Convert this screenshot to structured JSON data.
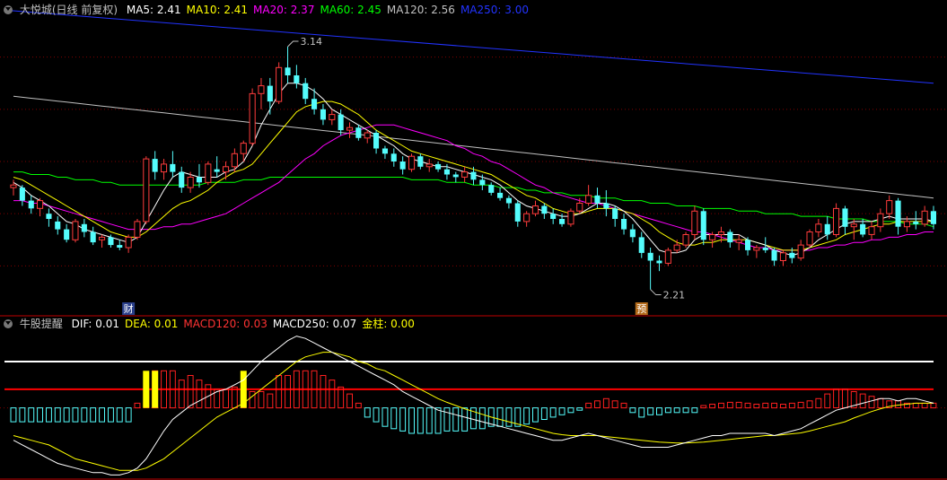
{
  "main_legend": {
    "title": "大悦城(日线 前复权)",
    "items": [
      {
        "label": "MA5: 2.41",
        "color": "#ffffff"
      },
      {
        "label": "MA10: 2.41",
        "color": "#ffff00"
      },
      {
        "label": "MA20: 2.37",
        "color": "#ff00ff"
      },
      {
        "label": "MA60: 2.45",
        "color": "#00ff00"
      },
      {
        "label": "MA120: 2.56",
        "color": "#c0c0c0"
      },
      {
        "label": "MA250: 3.00",
        "color": "#2233ff"
      }
    ]
  },
  "macd_legend": {
    "title": "牛股提醒",
    "items": [
      {
        "label": "DIF: 0.01",
        "color": "#ffffff"
      },
      {
        "label": "DEA: 0.01",
        "color": "#ffff00"
      },
      {
        "label": "MACD120: 0.03",
        "color": "#ff3333"
      },
      {
        "label": "MACD250: 0.07",
        "color": "#ffffff"
      },
      {
        "label": "金柱: 0.00",
        "color": "#ffff00"
      }
    ]
  },
  "annotations": {
    "high_label": "3.14",
    "low_label": "2.21",
    "marker_cai": "财",
    "marker_yu": "预"
  },
  "colors": {
    "up": "#ff3c3c",
    "down": "#54fcfc",
    "grid": "#800000",
    "ma5": "#ffffff",
    "ma10": "#ffff00",
    "ma20": "#ff00ff",
    "ma60": "#00ff00",
    "ma120": "#c0c0c0",
    "ma250": "#2233ff"
  },
  "chart_data": {
    "type": "candlestick",
    "price_range": [
      2.15,
      3.25
    ],
    "candles": [
      [
        2.6,
        2.63,
        2.57,
        2.61
      ],
      [
        2.6,
        2.61,
        2.53,
        2.55
      ],
      [
        2.55,
        2.57,
        2.5,
        2.52
      ],
      [
        2.52,
        2.56,
        2.49,
        2.55
      ],
      [
        2.5,
        2.52,
        2.45,
        2.48
      ],
      [
        2.47,
        2.49,
        2.42,
        2.44
      ],
      [
        2.44,
        2.46,
        2.39,
        2.4
      ],
      [
        2.4,
        2.48,
        2.39,
        2.47
      ],
      [
        2.46,
        2.48,
        2.41,
        2.43
      ],
      [
        2.43,
        2.45,
        2.38,
        2.39
      ],
      [
        2.4,
        2.42,
        2.37,
        2.41
      ],
      [
        2.41,
        2.42,
        2.37,
        2.38
      ],
      [
        2.38,
        2.4,
        2.36,
        2.37
      ],
      [
        2.37,
        2.42,
        2.35,
        2.41
      ],
      [
        2.41,
        2.48,
        2.4,
        2.47
      ],
      [
        2.47,
        2.72,
        2.46,
        2.71
      ],
      [
        2.71,
        2.74,
        2.63,
        2.66
      ],
      [
        2.66,
        2.71,
        2.63,
        2.69
      ],
      [
        2.69,
        2.74,
        2.64,
        2.66
      ],
      [
        2.66,
        2.68,
        2.58,
        2.6
      ],
      [
        2.6,
        2.66,
        2.58,
        2.64
      ],
      [
        2.64,
        2.69,
        2.6,
        2.62
      ],
      [
        2.62,
        2.7,
        2.61,
        2.69
      ],
      [
        2.67,
        2.72,
        2.64,
        2.66
      ],
      [
        2.66,
        2.7,
        2.63,
        2.68
      ],
      [
        2.68,
        2.75,
        2.66,
        2.73
      ],
      [
        2.73,
        2.78,
        2.7,
        2.77
      ],
      [
        2.77,
        2.98,
        2.76,
        2.96
      ],
      [
        2.96,
        3.02,
        2.9,
        2.99
      ],
      [
        2.99,
        3.02,
        2.88,
        2.93
      ],
      [
        2.93,
        3.08,
        2.92,
        3.06
      ],
      [
        3.06,
        3.14,
        3.0,
        3.03
      ],
      [
        3.03,
        3.07,
        2.98,
        3.0
      ],
      [
        3.0,
        3.02,
        2.92,
        2.94
      ],
      [
        2.94,
        2.98,
        2.88,
        2.9
      ],
      [
        2.9,
        2.92,
        2.84,
        2.86
      ],
      [
        2.86,
        2.9,
        2.84,
        2.88
      ],
      [
        2.88,
        2.9,
        2.8,
        2.82
      ],
      [
        2.82,
        2.85,
        2.79,
        2.83
      ],
      [
        2.83,
        2.84,
        2.78,
        2.79
      ],
      [
        2.79,
        2.82,
        2.77,
        2.81
      ],
      [
        2.81,
        2.82,
        2.73,
        2.75
      ],
      [
        2.75,
        2.76,
        2.71,
        2.73
      ],
      [
        2.73,
        2.75,
        2.68,
        2.7
      ],
      [
        2.7,
        2.72,
        2.65,
        2.67
      ],
      [
        2.67,
        2.73,
        2.66,
        2.72
      ],
      [
        2.72,
        2.73,
        2.67,
        2.68
      ],
      [
        2.68,
        2.71,
        2.66,
        2.69
      ],
      [
        2.69,
        2.7,
        2.66,
        2.67
      ],
      [
        2.67,
        2.69,
        2.63,
        2.65
      ],
      [
        2.65,
        2.66,
        2.62,
        2.64
      ],
      [
        2.64,
        2.68,
        2.62,
        2.66
      ],
      [
        2.66,
        2.68,
        2.61,
        2.63
      ],
      [
        2.63,
        2.65,
        2.59,
        2.61
      ],
      [
        2.61,
        2.62,
        2.57,
        2.58
      ],
      [
        2.58,
        2.6,
        2.55,
        2.56
      ],
      [
        2.56,
        2.57,
        2.52,
        2.54
      ],
      [
        2.54,
        2.55,
        2.45,
        2.47
      ],
      [
        2.47,
        2.51,
        2.45,
        2.5
      ],
      [
        2.5,
        2.55,
        2.49,
        2.53
      ],
      [
        2.53,
        2.54,
        2.48,
        2.5
      ],
      [
        2.5,
        2.52,
        2.46,
        2.48
      ],
      [
        2.48,
        2.5,
        2.45,
        2.46
      ],
      [
        2.46,
        2.52,
        2.45,
        2.51
      ],
      [
        2.51,
        2.56,
        2.5,
        2.54
      ],
      [
        2.54,
        2.61,
        2.53,
        2.57
      ],
      [
        2.57,
        2.6,
        2.52,
        2.54
      ],
      [
        2.54,
        2.59,
        2.49,
        2.52
      ],
      [
        2.52,
        2.53,
        2.45,
        2.48
      ],
      [
        2.48,
        2.5,
        2.42,
        2.44
      ],
      [
        2.44,
        2.46,
        2.39,
        2.41
      ],
      [
        2.41,
        2.43,
        2.33,
        2.35
      ],
      [
        2.35,
        2.37,
        2.21,
        2.32
      ],
      [
        2.32,
        2.34,
        2.28,
        2.31
      ],
      [
        2.31,
        2.37,
        2.3,
        2.36
      ],
      [
        2.36,
        2.4,
        2.35,
        2.38
      ],
      [
        2.38,
        2.43,
        2.37,
        2.42
      ],
      [
        2.42,
        2.53,
        2.4,
        2.51
      ],
      [
        2.51,
        2.52,
        2.38,
        2.4
      ],
      [
        2.4,
        2.43,
        2.37,
        2.42
      ],
      [
        2.42,
        2.45,
        2.39,
        2.43
      ],
      [
        2.43,
        2.44,
        2.37,
        2.39
      ],
      [
        2.39,
        2.42,
        2.36,
        2.4
      ],
      [
        2.4,
        2.41,
        2.34,
        2.36
      ],
      [
        2.36,
        2.38,
        2.33,
        2.37
      ],
      [
        2.37,
        2.41,
        2.35,
        2.36
      ],
      [
        2.36,
        2.37,
        2.3,
        2.32
      ],
      [
        2.32,
        2.36,
        2.3,
        2.35
      ],
      [
        2.35,
        2.37,
        2.31,
        2.33
      ],
      [
        2.33,
        2.4,
        2.32,
        2.38
      ],
      [
        2.38,
        2.44,
        2.37,
        2.43
      ],
      [
        2.43,
        2.48,
        2.41,
        2.46
      ],
      [
        2.46,
        2.49,
        2.4,
        2.42
      ],
      [
        2.42,
        2.54,
        2.41,
        2.52
      ],
      [
        2.52,
        2.53,
        2.42,
        2.45
      ],
      [
        2.45,
        2.48,
        2.4,
        2.46
      ],
      [
        2.46,
        2.48,
        2.41,
        2.42
      ],
      [
        2.42,
        2.47,
        2.4,
        2.45
      ],
      [
        2.45,
        2.52,
        2.43,
        2.5
      ],
      [
        2.5,
        2.57,
        2.48,
        2.55
      ],
      [
        2.55,
        2.56,
        2.42,
        2.45
      ],
      [
        2.45,
        2.49,
        2.43,
        2.47
      ],
      [
        2.47,
        2.51,
        2.44,
        2.46
      ],
      [
        2.46,
        2.53,
        2.45,
        2.51
      ],
      [
        2.51,
        2.53,
        2.44,
        2.46
      ]
    ],
    "ma5": [
      2.62,
      2.6,
      2.57,
      2.55,
      2.53,
      2.5,
      2.47,
      2.46,
      2.44,
      2.43,
      2.42,
      2.41,
      2.4,
      2.39,
      2.41,
      2.47,
      2.53,
      2.59,
      2.64,
      2.66,
      2.65,
      2.64,
      2.64,
      2.64,
      2.66,
      2.67,
      2.7,
      2.76,
      2.84,
      2.9,
      2.96,
      3.0,
      3.0,
      2.99,
      2.97,
      2.94,
      2.9,
      2.88,
      2.86,
      2.84,
      2.82,
      2.8,
      2.78,
      2.76,
      2.73,
      2.71,
      2.7,
      2.69,
      2.68,
      2.68,
      2.67,
      2.66,
      2.65,
      2.64,
      2.63,
      2.61,
      2.58,
      2.55,
      2.53,
      2.52,
      2.51,
      2.5,
      2.49,
      2.49,
      2.5,
      2.52,
      2.54,
      2.54,
      2.53,
      2.51,
      2.48,
      2.44,
      2.4,
      2.36,
      2.35,
      2.35,
      2.36,
      2.4,
      2.42,
      2.42,
      2.42,
      2.42,
      2.42,
      2.4,
      2.39,
      2.38,
      2.36,
      2.35,
      2.34,
      2.35,
      2.37,
      2.4,
      2.42,
      2.44,
      2.46,
      2.47,
      2.47,
      2.47,
      2.48,
      2.49,
      2.48,
      2.48,
      2.48,
      2.48,
      2.47
    ],
    "ma10": [
      2.64,
      2.63,
      2.61,
      2.59,
      2.57,
      2.55,
      2.53,
      2.51,
      2.49,
      2.47,
      2.45,
      2.43,
      2.42,
      2.41,
      2.41,
      2.43,
      2.46,
      2.49,
      2.52,
      2.54,
      2.55,
      2.57,
      2.59,
      2.62,
      2.64,
      2.66,
      2.67,
      2.69,
      2.73,
      2.77,
      2.81,
      2.85,
      2.89,
      2.91,
      2.92,
      2.93,
      2.93,
      2.92,
      2.9,
      2.88,
      2.85,
      2.82,
      2.8,
      2.78,
      2.76,
      2.74,
      2.73,
      2.72,
      2.71,
      2.7,
      2.69,
      2.68,
      2.67,
      2.66,
      2.65,
      2.63,
      2.61,
      2.59,
      2.57,
      2.56,
      2.54,
      2.52,
      2.51,
      2.5,
      2.5,
      2.51,
      2.52,
      2.52,
      2.52,
      2.51,
      2.5,
      2.48,
      2.46,
      2.43,
      2.41,
      2.39,
      2.38,
      2.38,
      2.39,
      2.39,
      2.4,
      2.4,
      2.4,
      2.4,
      2.39,
      2.38,
      2.37,
      2.36,
      2.36,
      2.36,
      2.37,
      2.38,
      2.39,
      2.4,
      2.42,
      2.43,
      2.44,
      2.45,
      2.46,
      2.46,
      2.47,
      2.47,
      2.47,
      2.47,
      2.47
    ],
    "ma20": [
      2.55,
      2.55,
      2.54,
      2.54,
      2.53,
      2.52,
      2.51,
      2.5,
      2.49,
      2.48,
      2.47,
      2.46,
      2.45,
      2.44,
      2.44,
      2.44,
      2.44,
      2.45,
      2.45,
      2.46,
      2.46,
      2.47,
      2.48,
      2.49,
      2.5,
      2.52,
      2.54,
      2.56,
      2.58,
      2.6,
      2.62,
      2.65,
      2.68,
      2.71,
      2.73,
      2.76,
      2.78,
      2.8,
      2.81,
      2.82,
      2.83,
      2.84,
      2.84,
      2.84,
      2.83,
      2.82,
      2.81,
      2.8,
      2.79,
      2.78,
      2.76,
      2.75,
      2.73,
      2.72,
      2.7,
      2.69,
      2.67,
      2.65,
      2.63,
      2.61,
      2.6,
      2.58,
      2.57,
      2.56,
      2.55,
      2.54,
      2.54,
      2.53,
      2.52,
      2.51,
      2.5,
      2.49,
      2.48,
      2.47,
      2.46,
      2.45,
      2.44,
      2.43,
      2.43,
      2.42,
      2.41,
      2.4,
      2.39,
      2.38,
      2.37,
      2.37,
      2.36,
      2.36,
      2.36,
      2.36,
      2.36,
      2.37,
      2.37,
      2.38,
      2.38,
      2.39,
      2.39,
      2.4,
      2.4,
      2.41,
      2.41,
      2.42,
      2.42,
      2.43,
      2.43
    ],
    "ma60": [
      2.66,
      2.66,
      2.65,
      2.65,
      2.65,
      2.64,
      2.64,
      2.63,
      2.63,
      2.63,
      2.62,
      2.62,
      2.61,
      2.61,
      2.61,
      2.61,
      2.61,
      2.61,
      2.61,
      2.61,
      2.61,
      2.61,
      2.62,
      2.62,
      2.62,
      2.62,
      2.63,
      2.63,
      2.63,
      2.64,
      2.64,
      2.64,
      2.64,
      2.64,
      2.64,
      2.64,
      2.64,
      2.64,
      2.64,
      2.64,
      2.64,
      2.64,
      2.64,
      2.64,
      2.64,
      2.63,
      2.63,
      2.63,
      2.63,
      2.62,
      2.62,
      2.62,
      2.61,
      2.61,
      2.61,
      2.6,
      2.6,
      2.6,
      2.59,
      2.59,
      2.58,
      2.58,
      2.58,
      2.57,
      2.57,
      2.57,
      2.56,
      2.56,
      2.56,
      2.55,
      2.55,
      2.55,
      2.54,
      2.54,
      2.54,
      2.53,
      2.53,
      2.53,
      2.52,
      2.52,
      2.52,
      2.52,
      2.51,
      2.51,
      2.51,
      2.5,
      2.5,
      2.5,
      2.5,
      2.49,
      2.49,
      2.49,
      2.49,
      2.48,
      2.48,
      2.48,
      2.48,
      2.47,
      2.47,
      2.47,
      2.47,
      2.46,
      2.46,
      2.46,
      2.45
    ],
    "ma120_range": [
      2.95,
      2.56
    ],
    "ma250_range": [
      3.28,
      3.0
    ],
    "macd_range": [
      -0.15,
      0.16
    ],
    "dif": [
      -0.07,
      -0.08,
      -0.09,
      -0.1,
      -0.11,
      -0.12,
      -0.125,
      -0.13,
      -0.135,
      -0.14,
      -0.14,
      -0.145,
      -0.145,
      -0.14,
      -0.13,
      -0.11,
      -0.08,
      -0.05,
      -0.025,
      -0.01,
      0.005,
      0.015,
      0.025,
      0.035,
      0.04,
      0.05,
      0.06,
      0.08,
      0.1,
      0.115,
      0.13,
      0.145,
      0.155,
      0.15,
      0.14,
      0.13,
      0.12,
      0.11,
      0.1,
      0.09,
      0.08,
      0.07,
      0.06,
      0.05,
      0.035,
      0.025,
      0.015,
      0.005,
      -0.005,
      -0.01,
      -0.015,
      -0.02,
      -0.025,
      -0.03,
      -0.035,
      -0.04,
      -0.045,
      -0.05,
      -0.055,
      -0.06,
      -0.065,
      -0.07,
      -0.07,
      -0.065,
      -0.06,
      -0.055,
      -0.06,
      -0.065,
      -0.07,
      -0.075,
      -0.08,
      -0.085,
      -0.085,
      -0.085,
      -0.085,
      -0.08,
      -0.075,
      -0.07,
      -0.065,
      -0.06,
      -0.06,
      -0.055,
      -0.055,
      -0.055,
      -0.055,
      -0.055,
      -0.06,
      -0.055,
      -0.05,
      -0.045,
      -0.035,
      -0.025,
      -0.015,
      -0.005,
      0.0,
      0.005,
      0.01,
      0.015,
      0.02,
      0.02,
      0.015,
      0.02,
      0.02,
      0.015,
      0.01
    ],
    "dea": [
      -0.06,
      -0.065,
      -0.07,
      -0.075,
      -0.08,
      -0.09,
      -0.1,
      -0.11,
      -0.115,
      -0.12,
      -0.125,
      -0.13,
      -0.135,
      -0.135,
      -0.135,
      -0.13,
      -0.12,
      -0.11,
      -0.095,
      -0.08,
      -0.065,
      -0.05,
      -0.035,
      -0.02,
      -0.01,
      0.0,
      0.01,
      0.025,
      0.04,
      0.055,
      0.07,
      0.085,
      0.1,
      0.11,
      0.115,
      0.12,
      0.12,
      0.115,
      0.11,
      0.1,
      0.095,
      0.085,
      0.08,
      0.07,
      0.06,
      0.05,
      0.04,
      0.03,
      0.02,
      0.012,
      0.005,
      -0.002,
      -0.008,
      -0.014,
      -0.02,
      -0.025,
      -0.03,
      -0.035,
      -0.04,
      -0.045,
      -0.05,
      -0.055,
      -0.058,
      -0.06,
      -0.06,
      -0.06,
      -0.06,
      -0.062,
      -0.064,
      -0.066,
      -0.068,
      -0.07,
      -0.072,
      -0.074,
      -0.075,
      -0.076,
      -0.076,
      -0.075,
      -0.074,
      -0.072,
      -0.07,
      -0.068,
      -0.066,
      -0.064,
      -0.062,
      -0.06,
      -0.06,
      -0.058,
      -0.056,
      -0.054,
      -0.05,
      -0.045,
      -0.04,
      -0.035,
      -0.03,
      -0.022,
      -0.015,
      -0.008,
      -0.002,
      0.003,
      0.006,
      0.008,
      0.01,
      0.01,
      0.01
    ],
    "macd_hist": [
      -0.03,
      -0.03,
      -0.03,
      -0.03,
      -0.03,
      -0.03,
      -0.03,
      -0.03,
      -0.03,
      -0.03,
      -0.03,
      -0.03,
      -0.03,
      -0.03,
      0.01,
      0.04,
      0.08,
      0.08,
      0.08,
      0.06,
      0.07,
      0.06,
      0.05,
      0.04,
      0.04,
      0.045,
      0.04,
      0.035,
      0.035,
      0.03,
      0.07,
      0.07,
      0.08,
      0.08,
      0.08,
      0.07,
      0.06,
      0.045,
      0.03,
      0.01,
      -0.02,
      -0.03,
      -0.04,
      -0.045,
      -0.05,
      -0.055,
      -0.055,
      -0.055,
      -0.055,
      -0.05,
      -0.05,
      -0.05,
      -0.045,
      -0.045,
      -0.04,
      -0.04,
      -0.04,
      -0.04,
      -0.035,
      -0.03,
      -0.025,
      -0.02,
      -0.015,
      -0.01,
      -0.005,
      0.01,
      0.015,
      0.02,
      0.015,
      0.01,
      -0.01,
      -0.02,
      -0.015,
      -0.015,
      -0.01,
      -0.01,
      -0.01,
      -0.01,
      0.005,
      0.008,
      0.01,
      0.012,
      0.012,
      0.01,
      0.008,
      0.01,
      0.01,
      0.008,
      0.01,
      0.012,
      0.015,
      0.02,
      0.03,
      0.04,
      0.04,
      0.035,
      0.03,
      0.025,
      0.02,
      0.015,
      0.015,
      0.01,
      0.01,
      0.01,
      0.01
    ],
    "gold_bars": [
      15,
      16,
      26
    ],
    "white_level": 0.1,
    "red_level": 0.04
  }
}
